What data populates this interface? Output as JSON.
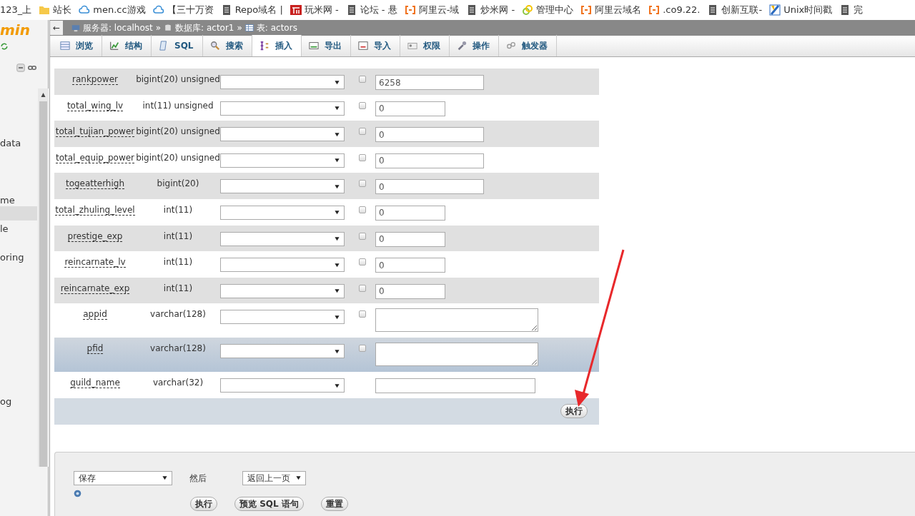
{
  "bookmarks": [
    {
      "label": "123_上",
      "kind": "plain"
    },
    {
      "label": "站长",
      "kind": "folder"
    },
    {
      "label": "men.cc游戏",
      "kind": "cloud"
    },
    {
      "label": "【三十万资",
      "kind": "cloud"
    },
    {
      "label": "Repo域名 |",
      "kind": "page"
    },
    {
      "label": "玩米网 -",
      "kind": "logo"
    },
    {
      "label": "论坛 - 悬",
      "kind": "page"
    },
    {
      "label": "阿里云-域",
      "kind": "bracket"
    },
    {
      "label": "炒米网 -",
      "kind": "page"
    },
    {
      "label": "管理中心",
      "kind": "ring"
    },
    {
      "label": "阿里云域名",
      "kind": "bracket"
    },
    {
      "label": ".co9.22.",
      "kind": "bracket"
    },
    {
      "label": "创新互联-",
      "kind": "page"
    },
    {
      "label": "Unix时间戳",
      "kind": "tile"
    },
    {
      "label": "完",
      "kind": "page"
    }
  ],
  "sidebar": {
    "logo": "min",
    "items": [
      {
        "label": "data",
        "selected": false
      },
      {
        "label": "me",
        "selected": false
      },
      {
        "selected": true
      },
      {
        "label": "le",
        "selected": false
      },
      {
        "label": "oring",
        "selected": false
      },
      {
        "label": "og",
        "selected": false
      }
    ]
  },
  "breadcrumb": {
    "back_button": "←",
    "items": [
      {
        "label": "服务器: localhost",
        "kind": "server",
        "separator": "»"
      },
      {
        "label": "数据库: actor1",
        "kind": "database",
        "separator": "»"
      },
      {
        "label": "表: actors",
        "kind": "table"
      }
    ]
  },
  "tabs": [
    {
      "label": "浏览",
      "kind": "browse",
      "selected": false
    },
    {
      "label": "结构",
      "kind": "structure",
      "selected": false
    },
    {
      "label": "SQL",
      "kind": "sql",
      "selected": false
    },
    {
      "label": "搜索",
      "kind": "search",
      "selected": false
    },
    {
      "label": "插入",
      "kind": "insert",
      "selected": true
    },
    {
      "label": "导出",
      "kind": "export",
      "selected": false
    },
    {
      "label": "导入",
      "kind": "import",
      "selected": false
    },
    {
      "label": "权限",
      "kind": "privileges",
      "selected": false
    },
    {
      "label": "操作",
      "kind": "wrench",
      "selected": false
    },
    {
      "label": "触发器",
      "kind": "triggers",
      "selected": false
    }
  ],
  "fields": [
    {
      "name": "rankpower",
      "type": "bigint(20) unsigned",
      "kind": "long",
      "nullable": true,
      "null_checked": false,
      "value": "6258",
      "highlighted": false
    },
    {
      "name": "total_wing_lv",
      "type": "int(11) unsigned",
      "kind": "short",
      "nullable": true,
      "null_checked": false,
      "value": "0",
      "highlighted": false
    },
    {
      "name": "total_tujian_power",
      "type": "bigint(20) unsigned",
      "kind": "long",
      "nullable": true,
      "null_checked": false,
      "value": "0",
      "highlighted": false
    },
    {
      "name": "total_equip_power",
      "type": "bigint(20) unsigned",
      "kind": "long",
      "nullable": true,
      "null_checked": false,
      "value": "0",
      "highlighted": false
    },
    {
      "name": "togeatterhigh",
      "type": "bigint(20)",
      "kind": "long",
      "nullable": true,
      "null_checked": false,
      "value": "0",
      "highlighted": false
    },
    {
      "name": "total_zhuling_level",
      "type": "int(11)",
      "kind": "short",
      "nullable": true,
      "null_checked": false,
      "value": "0",
      "highlighted": false
    },
    {
      "name": "prestige_exp",
      "type": "int(11)",
      "kind": "short",
      "nullable": true,
      "null_checked": false,
      "value": "0",
      "highlighted": false
    },
    {
      "name": "reincarnate_lv",
      "type": "int(11)",
      "kind": "short",
      "nullable": true,
      "null_checked": false,
      "value": "0",
      "highlighted": false
    },
    {
      "name": "reincarnate_exp",
      "type": "int(11)",
      "kind": "short",
      "nullable": true,
      "null_checked": false,
      "value": "0",
      "highlighted": false
    },
    {
      "name": "appid",
      "type": "varchar(128)",
      "kind": "textarea",
      "nullable": true,
      "null_checked": false,
      "highlighted": false
    },
    {
      "name": "pfid",
      "type": "varchar(128)",
      "kind": "textarea",
      "nullable": true,
      "null_checked": false,
      "highlighted": true
    },
    {
      "name": "guild_name",
      "type": "varchar(32)",
      "kind": "wide",
      "nullable": false,
      "highlighted": false
    }
  ],
  "table_submit": "执行",
  "bottom": {
    "action_select": "保存",
    "then_label": "然后",
    "after_select": "返回上一页",
    "buttons": [
      "执行",
      "预览 SQL 语句",
      "重置"
    ]
  }
}
